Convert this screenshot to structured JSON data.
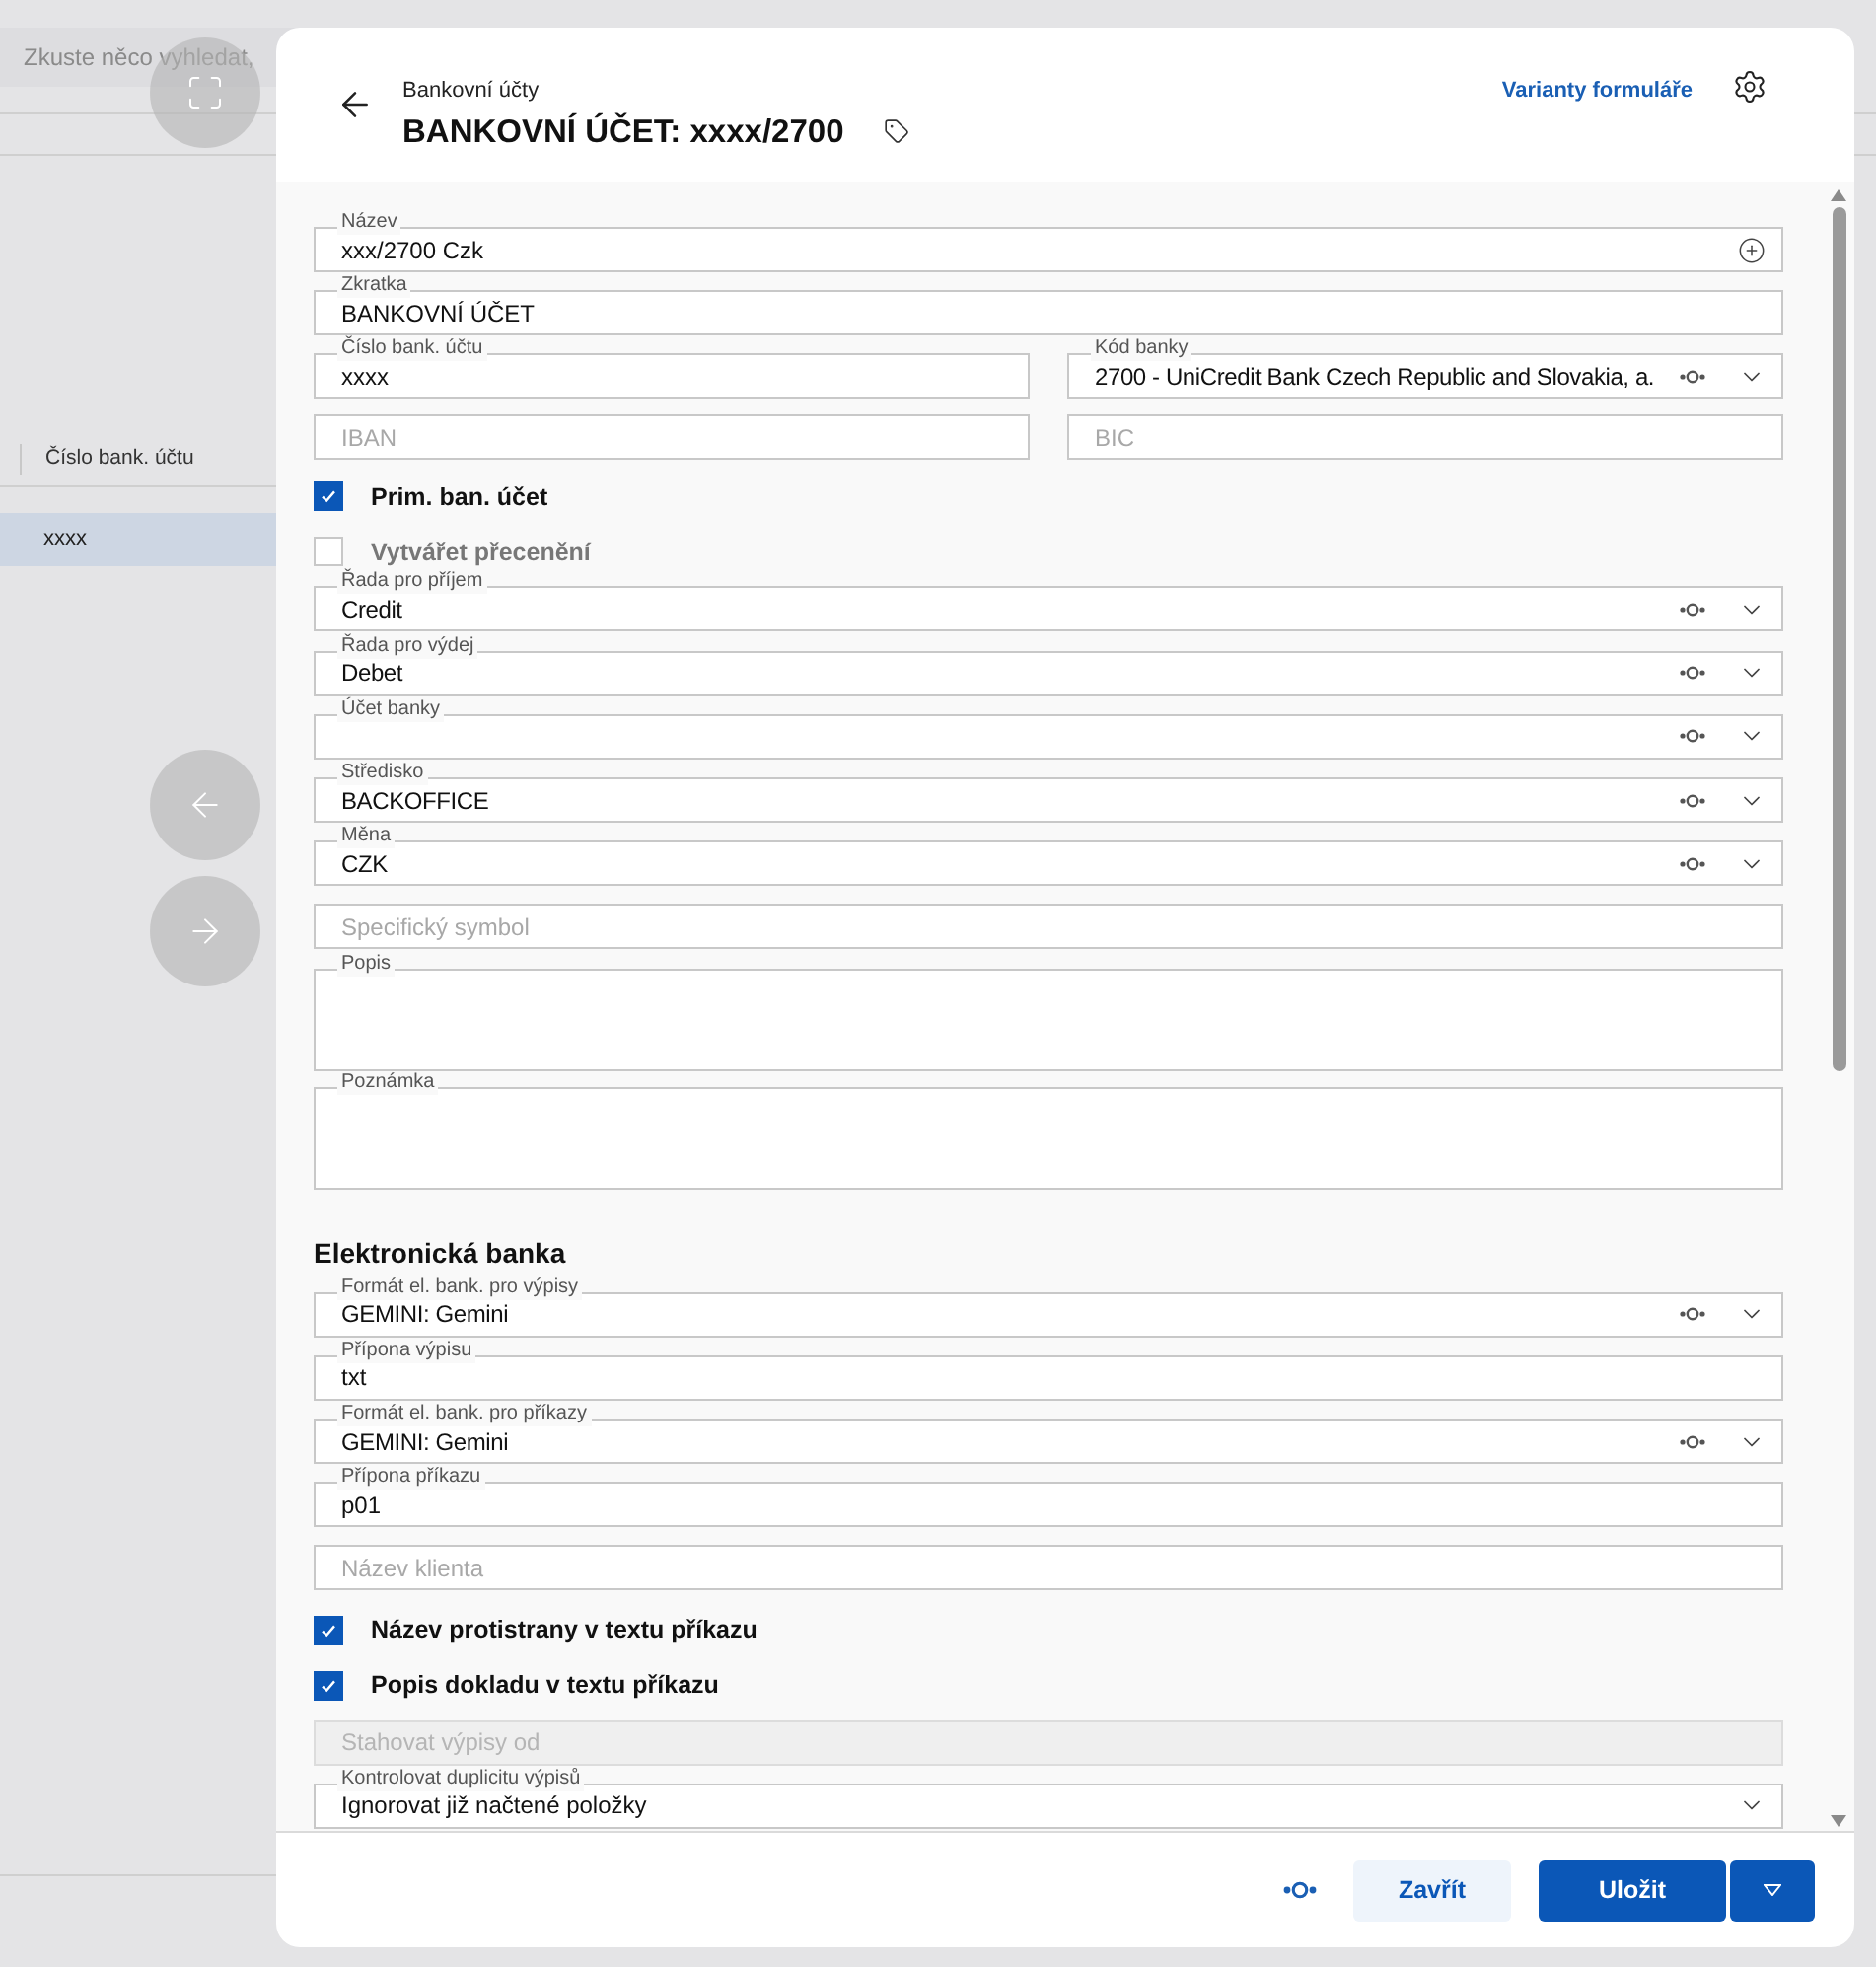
{
  "background": {
    "search": {
      "placeholder": "Zkuste něco vyhledat,"
    },
    "list": {
      "column": "Číslo bank. účtu",
      "rows": [
        {
          "cells": [
            "xxxx"
          ],
          "selected": true
        }
      ]
    }
  },
  "modal": {
    "breadcrumb": "Bankovní účty",
    "title": "BANKOVNÍ ÚČET: xxxx/2700",
    "variants_link": "Varianty formuláře",
    "items": [
      {
        "kind": "addable",
        "label": "Název",
        "value": "xxx/2700 Czk"
      },
      {
        "kind": "text",
        "label": "Zkratka",
        "value": "BANKOVNÍ ÚČET"
      },
      {
        "kind": "row",
        "fields": [
          {
            "kind": "text",
            "label": "Číslo bank. účtu",
            "value": "xxxx"
          },
          {
            "kind": "lookup",
            "label": "Kód banky",
            "value": "2700 - UniCredit Bank Czech Republic and Slovakia, a."
          }
        ]
      },
      {
        "kind": "row",
        "fields": [
          {
            "kind": "text",
            "placeholder": "IBAN"
          },
          {
            "kind": "text",
            "placeholder": "BIC"
          }
        ]
      },
      {
        "kind": "checkbox",
        "label": "Prim. ban. účet",
        "checked": true
      },
      {
        "kind": "checkbox",
        "label": "Vytvářet přecenění",
        "checked": false
      },
      {
        "kind": "lookup",
        "label": "Řada pro příjem",
        "value": "Credit"
      },
      {
        "kind": "lookup",
        "label": "Řada pro výdej",
        "value": "Debet"
      },
      {
        "kind": "lookup",
        "label": "Účet banky"
      },
      {
        "kind": "lookup",
        "label": "Středisko",
        "value": "BACKOFFICE"
      },
      {
        "kind": "lookup",
        "label": "Měna",
        "value": "CZK"
      },
      {
        "kind": "text",
        "placeholder": "Specifický symbol"
      },
      {
        "kind": "textarea",
        "label": "Popis"
      },
      {
        "kind": "textarea",
        "label": "Poznámka"
      },
      {
        "kind": "heading",
        "label": "Elektronická banka"
      },
      {
        "kind": "lookup",
        "label": "Formát el. bank. pro výpisy",
        "value": "GEMINI: Gemini"
      },
      {
        "kind": "text",
        "label": "Přípona výpisu",
        "value": "txt"
      },
      {
        "kind": "lookup",
        "label": "Formát el. bank. pro příkazy",
        "value": "GEMINI: Gemini"
      },
      {
        "kind": "text",
        "label": "Přípona příkazu",
        "value": "p01"
      },
      {
        "kind": "text",
        "placeholder": "Název klienta"
      },
      {
        "kind": "checkbox",
        "label": "Název protistrany v textu příkazu",
        "checked": true
      },
      {
        "kind": "checkbox",
        "label": "Popis dokladu v textu příkazu",
        "checked": true
      },
      {
        "kind": "text",
        "placeholder": "Stahovat výpisy od",
        "disabled": true
      },
      {
        "kind": "select",
        "label": "Kontrolovat duplicitu výpisů",
        "value": "Ignorovat již načtené položky"
      }
    ],
    "buttons": {
      "close": "Zavřít",
      "save": "Uložit"
    }
  }
}
